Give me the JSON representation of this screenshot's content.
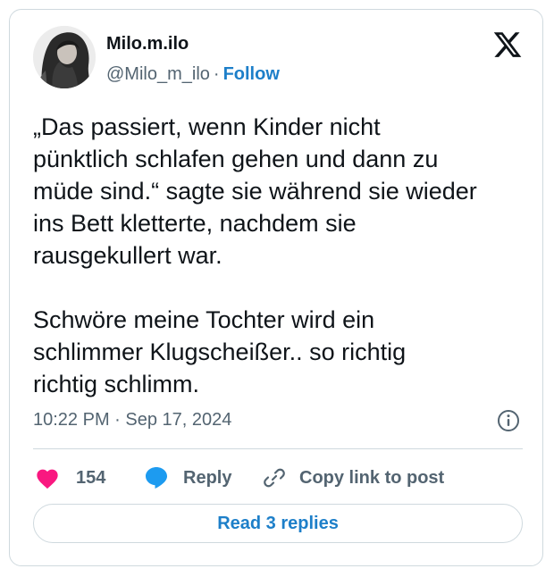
{
  "user": {
    "display_name": "Milo.m.ilo",
    "handle": "@Milo_m_ilo",
    "separator": "·",
    "follow_label": "Follow"
  },
  "tweet": {
    "paragraphs": [
      "„Das passiert, wenn Kinder nicht\npünktlich schlafen gehen und dann zu\nmüde sind.“ sagte sie während sie wieder\nins Bett kletterte, nachdem sie\nrausgekullert war.",
      "Schwöre meine Tochter wird ein\nschlimmer Klugscheißer.. so richtig\nrichtig schlimm."
    ],
    "timestamp": "10:22 PM · Sep 17, 2024"
  },
  "actions": {
    "like_count": "154",
    "reply_label": "Reply",
    "copy_label": "Copy link to post"
  },
  "footer": {
    "read_replies_label": "Read 3 replies"
  },
  "icons": {
    "brand": "x-logo-icon",
    "info": "info-icon",
    "like": "heart-icon",
    "reply": "speech-bubble-icon",
    "copy": "link-icon"
  },
  "colors": {
    "link_blue": "#1d7fc9",
    "heart_pink": "#f91880",
    "reply_blue": "#1d9bf0",
    "muted_text": "#536471",
    "border": "#cfd9de"
  }
}
